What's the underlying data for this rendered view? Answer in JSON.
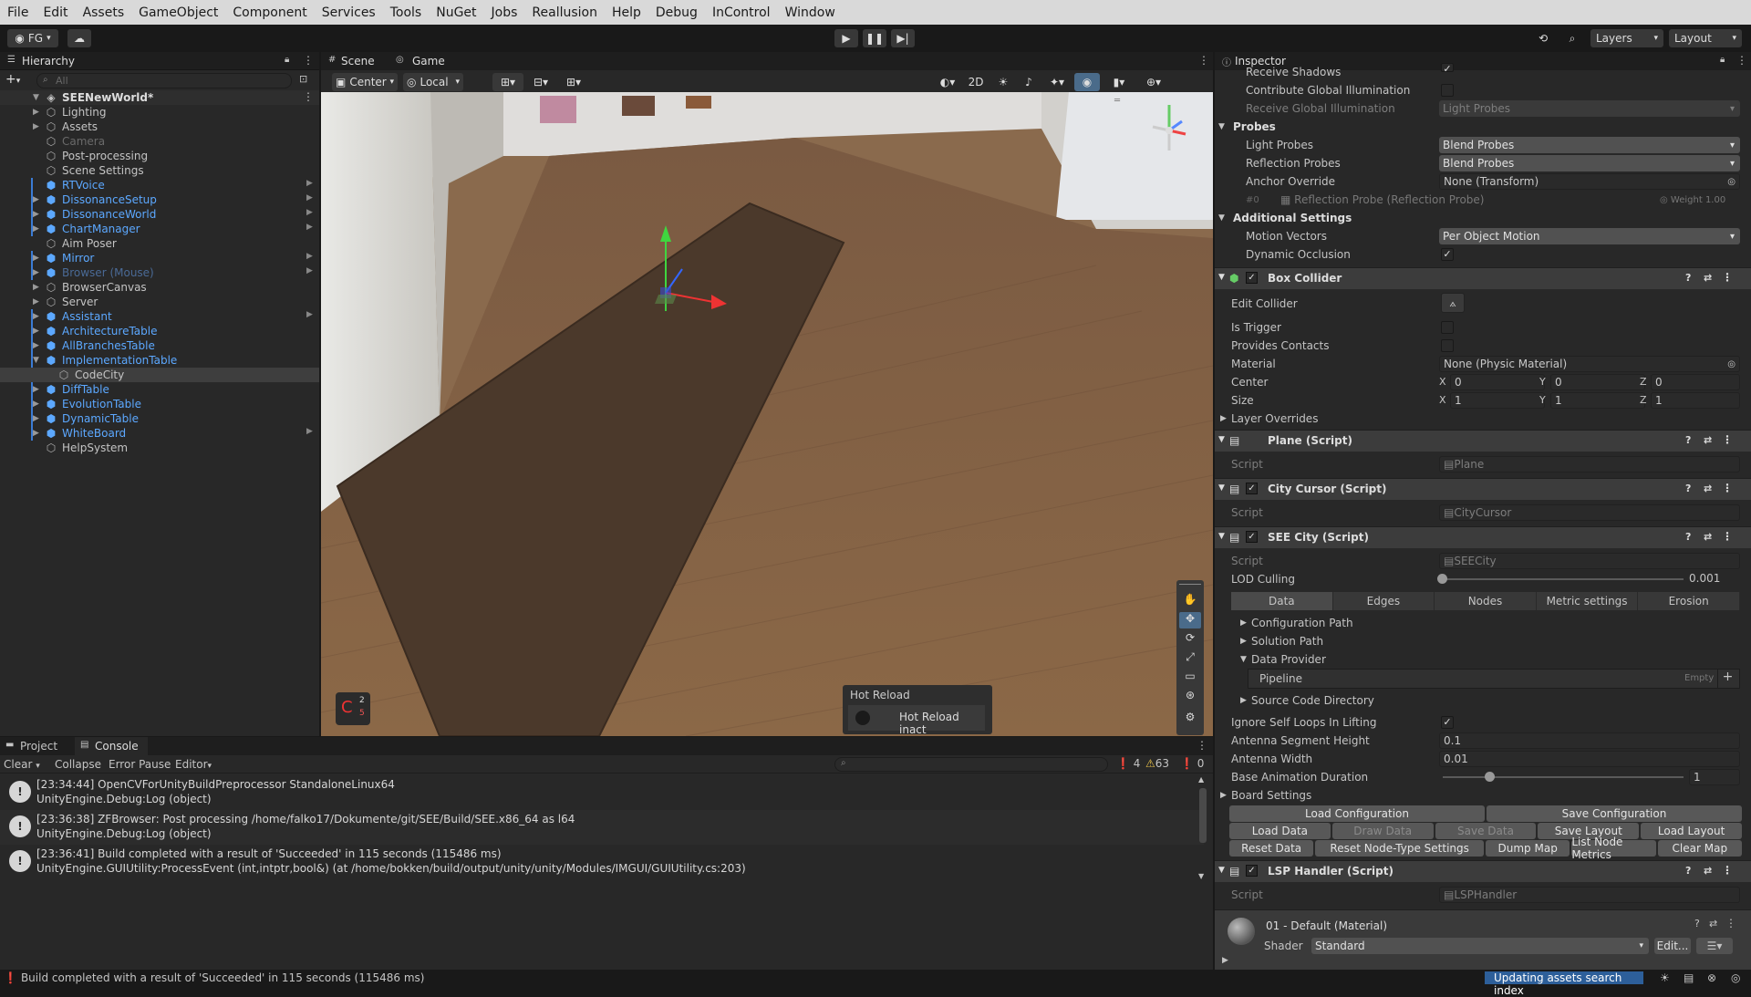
{
  "menu": [
    "File",
    "Edit",
    "Assets",
    "GameObject",
    "Component",
    "Services",
    "Tools",
    "NuGet",
    "Jobs",
    "Reallusion",
    "Help",
    "Debug",
    "InControl",
    "Window"
  ],
  "toolbar": {
    "account": "FG",
    "layers": "Layers",
    "layout": "Layout"
  },
  "hierarchy": {
    "tab": "Hierarchy",
    "search_placeholder": "All",
    "scene": "SEENewWorld*",
    "items": [
      {
        "label": "Lighting",
        "color": "#c4c4c4",
        "indent": 1,
        "arrow": true,
        "icon": "gameobject"
      },
      {
        "label": "Assets",
        "color": "#c4c4c4",
        "indent": 1,
        "arrow": true,
        "icon": "gameobject"
      },
      {
        "label": "Camera",
        "color": "#6a6a6a",
        "indent": 1,
        "arrow": false,
        "icon": "gameobject"
      },
      {
        "label": "Post-processing",
        "color": "#c4c4c4",
        "indent": 1,
        "arrow": false,
        "icon": "gameobject"
      },
      {
        "label": "Scene Settings",
        "color": "#c4c4c4",
        "indent": 1,
        "arrow": false,
        "icon": "gameobject"
      },
      {
        "label": "RTVoice",
        "color": "#5ca8ff",
        "indent": 1,
        "arrow": false,
        "icon": "prefab",
        "more": true
      },
      {
        "label": "DissonanceSetup",
        "color": "#5ca8ff",
        "indent": 1,
        "arrow": true,
        "icon": "prefab",
        "more": true
      },
      {
        "label": "DissonanceWorld",
        "color": "#5ca8ff",
        "indent": 1,
        "arrow": true,
        "icon": "prefab",
        "more": true
      },
      {
        "label": "ChartManager",
        "color": "#5ca8ff",
        "indent": 1,
        "arrow": true,
        "icon": "prefab",
        "more": true
      },
      {
        "label": "Aim Poser",
        "color": "#c4c4c4",
        "indent": 1,
        "arrow": false,
        "icon": "gameobject"
      },
      {
        "label": "Mirror",
        "color": "#5ca8ff",
        "indent": 1,
        "arrow": true,
        "icon": "prefab",
        "more": true
      },
      {
        "label": "Browser (Mouse)",
        "color": "#4a6a96",
        "indent": 1,
        "arrow": true,
        "icon": "prefab",
        "more": true
      },
      {
        "label": "BrowserCanvas",
        "color": "#c4c4c4",
        "indent": 1,
        "arrow": true,
        "icon": "gameobject"
      },
      {
        "label": "Server",
        "color": "#c4c4c4",
        "indent": 1,
        "arrow": true,
        "icon": "gameobject"
      },
      {
        "label": "Assistant",
        "color": "#5ca8ff",
        "indent": 1,
        "arrow": true,
        "icon": "prefab",
        "more": true
      },
      {
        "label": "ArchitectureTable",
        "color": "#5ca8ff",
        "indent": 1,
        "arrow": true,
        "icon": "prefab"
      },
      {
        "label": "AllBranchesTable",
        "color": "#5ca8ff",
        "indent": 1,
        "arrow": true,
        "icon": "prefab"
      },
      {
        "label": "ImplementationTable",
        "color": "#5ca8ff",
        "indent": 1,
        "arrow": true,
        "icon": "prefab",
        "open": true
      },
      {
        "label": "CodeCity",
        "color": "#c4c4c4",
        "indent": 2,
        "arrow": false,
        "icon": "gameobject",
        "selected": true
      },
      {
        "label": "DiffTable",
        "color": "#5ca8ff",
        "indent": 1,
        "arrow": true,
        "icon": "prefab"
      },
      {
        "label": "EvolutionTable",
        "color": "#5ca8ff",
        "indent": 1,
        "arrow": true,
        "icon": "prefab"
      },
      {
        "label": "DynamicTable",
        "color": "#5ca8ff",
        "indent": 1,
        "arrow": true,
        "icon": "prefab"
      },
      {
        "label": "WhiteBoard",
        "color": "#5ca8ff",
        "indent": 1,
        "arrow": true,
        "icon": "prefab",
        "more": true
      },
      {
        "label": "HelpSystem",
        "color": "#c4c4c4",
        "indent": 1,
        "arrow": false,
        "icon": "gameobject"
      }
    ]
  },
  "scene": {
    "tabs": [
      "Scene",
      "Game"
    ],
    "pivot": "Center",
    "space": "Local",
    "mode_2d": "2D",
    "hot_reload_title": "Hot Reload",
    "hot_reload_status": "Hot Reload inact",
    "progress_top": "2",
    "progress_bottom": "5"
  },
  "bottom": {
    "tabs": [
      "Project",
      "Console"
    ],
    "clear": "Clear",
    "collapse": "Collapse",
    "error_pause": "Error Pause",
    "editor": "Editor",
    "counts": {
      "info": "4",
      "warn": "63",
      "error": "0"
    },
    "logs": [
      {
        "l1": "[23:34:44] OpenCVForUnityBuildPreprocessor StandaloneLinux64",
        "l2": "UnityEngine.Debug:Log (object)"
      },
      {
        "l1": "[23:36:38] ZFBrowser: Post processing /home/falko17/Dokumente/git/SEE/Build/SEE.x86_64 as l64",
        "l2": "UnityEngine.Debug:Log (object)"
      },
      {
        "l1": "[23:36:41] Build completed with a result of 'Succeeded' in 115 seconds (115486 ms)",
        "l2": "UnityEngine.GUIUtility:ProcessEvent (int,intptr,bool&) (at /home/bokken/build/output/unity/unity/Modules/IMGUI/GUIUtility.cs:203)"
      }
    ]
  },
  "inspector": {
    "tab": "Inspector",
    "receive_shadows": "Receive Shadows",
    "contribute_gi": "Contribute Global Illumination",
    "receive_gi": "Receive Global Illumination",
    "receive_gi_value": "Light Probes",
    "probes": "Probes",
    "light_probes": "Light Probes",
    "light_probes_value": "Blend Probes",
    "reflection_probes": "Reflection Probes",
    "reflection_probes_value": "Blend Probes",
    "anchor_override": "Anchor Override",
    "anchor_override_value": "None (Transform)",
    "probe_ref": "#0",
    "probe_ref_value": "Reflection Probe (Reflection Probe)",
    "probe_weight": "Weight 1.00",
    "additional": "Additional Settings",
    "motion_vectors": "Motion Vectors",
    "motion_vectors_value": "Per Object Motion",
    "dynamic_occlusion": "Dynamic Occlusion",
    "box_collider": "Box Collider",
    "edit_collider": "Edit Collider",
    "is_trigger": "Is Trigger",
    "provides_contacts": "Provides Contacts",
    "material": "Material",
    "material_value": "None (Physic Material)",
    "center": "Center",
    "center_xyz": [
      "0",
      "0",
      "0"
    ],
    "size": "Size",
    "size_xyz": [
      "1",
      "1",
      "1"
    ],
    "layer_overrides": "Layer Overrides",
    "plane_script": "Plane (Script)",
    "script_label": "Script",
    "plane_value": "Plane",
    "city_cursor": "City Cursor (Script)",
    "city_cursor_value": "CityCursor",
    "see_city": "SEE City (Script)",
    "see_city_value": "SEECity",
    "lod_culling": "LOD Culling",
    "lod_value": "0.001",
    "tabs": [
      "Data",
      "Edges",
      "Nodes",
      "Metric settings",
      "Erosion"
    ],
    "config_path": "Configuration Path",
    "solution_path": "Solution Path",
    "data_provider": "Data Provider",
    "pipeline": "Pipeline",
    "pipeline_value": "Empty",
    "source_dir": "Source Code Directory",
    "ignore_loops": "Ignore Self Loops In Lifting",
    "antenna_height": "Antenna Segment Height",
    "antenna_height_value": "0.1",
    "antenna_width": "Antenna Width",
    "antenna_width_value": "0.01",
    "base_anim": "Base Animation Duration",
    "base_anim_value": "1",
    "board_settings": "Board Settings",
    "btn_row1": [
      "Load Configuration",
      "Save Configuration"
    ],
    "btn_row2": [
      "Load Data",
      "Draw Data",
      "Save Data",
      "Save Layout",
      "Load Layout"
    ],
    "btn_row3": [
      "Reset Data",
      "Reset Node-Type Settings",
      "Dump Map",
      "List Node Metrics",
      "Clear Map"
    ],
    "lsp_handler": "LSP Handler (Script)",
    "lsp_value": "LSPHandler",
    "material_name": "01 - Default (Material)",
    "shader": "Shader",
    "shader_value": "Standard",
    "edit_btn": "Edit..."
  },
  "status": {
    "message": "Build completed with a result of 'Succeeded' in 115 seconds (115486 ms)",
    "right": "Updating assets search index"
  }
}
